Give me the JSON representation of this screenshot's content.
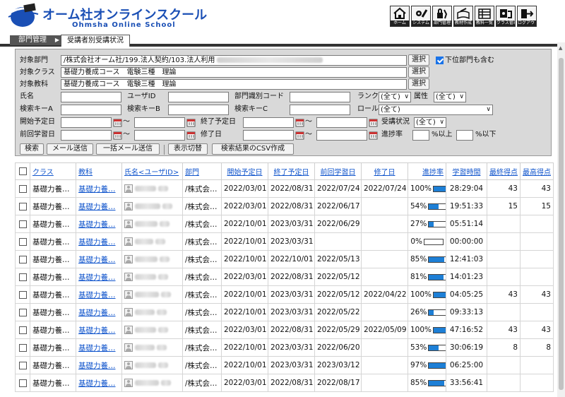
{
  "header": {
    "title": "オーム社オンラインスクール",
    "subtitle": "Ohmsha Online School",
    "tools": [
      {
        "label": "ホーム",
        "icon": "home-icon"
      },
      {
        "label": "システム",
        "icon": "system-icon"
      },
      {
        "label": "部門管理",
        "icon": "department-icon"
      },
      {
        "label": "教材作成",
        "icon": "material-create-icon"
      },
      {
        "label": "教科一覧",
        "icon": "subject-list-icon"
      },
      {
        "label": "クラス管理",
        "icon": "class-manage-icon"
      },
      {
        "label": "ログアウト",
        "icon": "logout-icon"
      }
    ]
  },
  "tabs": {
    "breadcrumb": "部門管理",
    "active": "受講者別受講状況"
  },
  "search": {
    "dept_label": "対象部門",
    "dept_value": "/株式会社オーム社/199.法人契約/103.法人利用",
    "dept_select": "選択",
    "include_sub_label": "下位部門も含む",
    "include_sub_checked": true,
    "class_label": "対象クラス",
    "class_value": "基礎力養成コース　電験三種　理論",
    "class_select": "選択",
    "subject_label": "対象教科",
    "subject_value": "基礎力養成コース　電験三種　理論",
    "subject_select": "選択",
    "name_label": "氏名",
    "userid_label": "ユーザID",
    "deptcode_label": "部門識別コード",
    "rank_label": "ランク",
    "rank_value": "(全て)",
    "attr_label": "属性",
    "attr_value": "(全て)",
    "key_a_label": "検索キーA",
    "key_b_label": "検索キーB",
    "key_c_label": "検索キーC",
    "role_label": "ロール",
    "role_value": "(全て)",
    "start_label": "開始予定日",
    "end_label": "終了予定日",
    "status_label": "受講状況",
    "status_value": "(全て)",
    "last_label": "前回学習日",
    "done_label": "修了日",
    "progress_label": "進捗率",
    "over_label": "%以上",
    "under_label": "%以下",
    "tilde": "～",
    "buttons": {
      "search": "検索",
      "mail": "メール送信",
      "bulk_mail": "一括メール送信",
      "toggle": "表示切替",
      "csv": "検索結果のCSV作成"
    }
  },
  "table": {
    "headers": [
      "クラス",
      "教科",
      "氏名<ユーザID>",
      "部門",
      "開始予定日",
      "終了予定日",
      "前回学習日",
      "修了日",
      "進捗率",
      "学習時間",
      "最終得点",
      "最高得点"
    ],
    "rows": [
      {
        "cls": "基礎力養…",
        "subj": "基礎力養…",
        "dept": "/株式会…",
        "start": "2022/03/01",
        "end": "2022/08/31",
        "last": "2022/07/24",
        "done": "2022/07/24",
        "prog": "100%",
        "pct": 100,
        "time": "28:29:04",
        "final": "43",
        "best": "43"
      },
      {
        "cls": "基礎力養…",
        "subj": "基礎力養…",
        "dept": "/株式会…",
        "start": "2022/03/01",
        "end": "2022/08/31",
        "last": "2022/06/17",
        "done": "",
        "prog": "54%",
        "pct": 54,
        "time": "19:51:33",
        "final": "15",
        "best": "15"
      },
      {
        "cls": "基礎力養…",
        "subj": "基礎力養…",
        "dept": "/株式会…",
        "start": "2022/10/01",
        "end": "2023/03/31",
        "last": "2022/06/29",
        "done": "",
        "prog": "27%",
        "pct": 27,
        "time": "05:51:14",
        "final": "",
        "best": ""
      },
      {
        "cls": "基礎力養…",
        "subj": "基礎力養…",
        "dept": "/株式会…",
        "start": "2022/10/01",
        "end": "2023/03/31",
        "last": "",
        "done": "",
        "prog": "0%",
        "pct": 0,
        "time": "00:00:00",
        "final": "",
        "best": ""
      },
      {
        "cls": "基礎力養…",
        "subj": "基礎力養…",
        "dept": "/株式会…",
        "start": "2022/10/01",
        "end": "2022/10/01",
        "last": "2022/05/13",
        "done": "",
        "prog": "85%",
        "pct": 85,
        "time": "12:41:03",
        "final": "",
        "best": ""
      },
      {
        "cls": "基礎力養…",
        "subj": "基礎力養…",
        "dept": "/株式会…",
        "start": "2022/03/01",
        "end": "2022/08/31",
        "last": "2022/05/12",
        "done": "",
        "prog": "81%",
        "pct": 81,
        "time": "14:01:23",
        "final": "",
        "best": ""
      },
      {
        "cls": "基礎力養…",
        "subj": "基礎力養…",
        "dept": "/株式会…",
        "start": "2022/10/01",
        "end": "2023/03/31",
        "last": "2022/05/12",
        "done": "2022/04/22",
        "prog": "100%",
        "pct": 100,
        "time": "04:05:25",
        "final": "43",
        "best": "43"
      },
      {
        "cls": "基礎力養…",
        "subj": "基礎力養…",
        "dept": "/株式会…",
        "start": "2022/10/01",
        "end": "2023/03/31",
        "last": "2022/05/22",
        "done": "",
        "prog": "26%",
        "pct": 26,
        "time": "09:33:13",
        "final": "",
        "best": ""
      },
      {
        "cls": "基礎力養…",
        "subj": "基礎力養…",
        "dept": "/株式会…",
        "start": "2022/03/01",
        "end": "2022/08/31",
        "last": "2022/05/29",
        "done": "2022/05/09",
        "prog": "100%",
        "pct": 100,
        "time": "47:16:52",
        "final": "43",
        "best": "43"
      },
      {
        "cls": "基礎力養…",
        "subj": "基礎力養…",
        "dept": "/株式会…",
        "start": "2022/10/01",
        "end": "2023/03/31",
        "last": "2022/06/20",
        "done": "",
        "prog": "53%",
        "pct": 53,
        "time": "30:06:19",
        "final": "8",
        "best": "8"
      },
      {
        "cls": "基礎力養…",
        "subj": "基礎力養…",
        "dept": "/株式会…",
        "start": "2022/10/01",
        "end": "2023/03/31",
        "last": "2023/03/12",
        "done": "",
        "prog": "97%",
        "pct": 97,
        "time": "06:25:00",
        "final": "",
        "best": ""
      },
      {
        "cls": "基礎力養…",
        "subj": "基礎力養…",
        "dept": "/株式会…",
        "start": "2022/03/01",
        "end": "2022/08/31",
        "last": "2022/08/17",
        "done": "",
        "prog": "85%",
        "pct": 85,
        "time": "33:56:41",
        "final": "",
        "best": ""
      }
    ]
  }
}
